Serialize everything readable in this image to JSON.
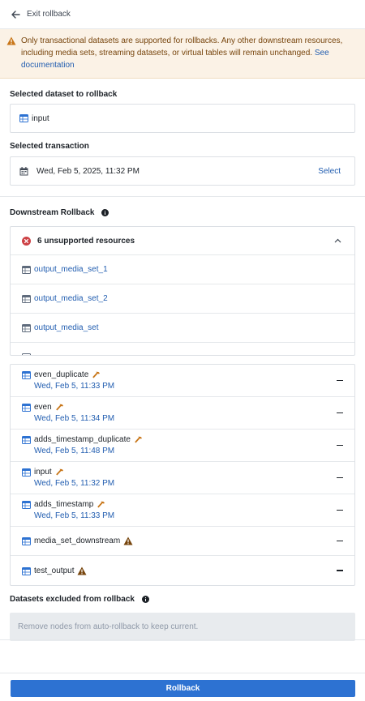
{
  "header": {
    "exit_label": "Exit rollback"
  },
  "warning": {
    "text": "Only transactional datasets are supported for rollbacks. Any other downstream resources, including media sets, streaming datasets, or virtual tables will remain unchanged.",
    "link": "See documentation"
  },
  "selected_dataset": {
    "label": "Selected dataset to rollback",
    "value": "input"
  },
  "selected_transaction": {
    "label": "Selected transaction",
    "value": "Wed, Feb 5, 2025, 11:32 PM",
    "action": "Select"
  },
  "downstream": {
    "label": "Downstream Rollback",
    "unsupported_title": "6 unsupported resources",
    "unsupported_items": [
      "output_media_set_1",
      "output_media_set_2",
      "output_media_set"
    ],
    "datasets": [
      {
        "name": "even_duplicate",
        "date": "Wed, Feb 5, 11:33 PM",
        "icon": "hammer-icon"
      },
      {
        "name": "even",
        "date": "Wed, Feb 5, 11:34 PM",
        "icon": "hammer-icon"
      },
      {
        "name": "adds_timestamp_duplicate",
        "date": "Wed, Feb 5, 11:48 PM",
        "icon": "hammer-icon"
      },
      {
        "name": "input",
        "date": "Wed, Feb 5, 11:32 PM",
        "icon": "hammer-icon"
      },
      {
        "name": "adds_timestamp",
        "date": "Wed, Feb 5, 11:33 PM",
        "icon": "hammer-icon"
      },
      {
        "name": "media_set_downstream",
        "date": "",
        "icon": "warning-icon"
      },
      {
        "name": "test_output",
        "date": "",
        "icon": "warning-icon"
      }
    ]
  },
  "excluded": {
    "label": "Datasets excluded from rollback",
    "placeholder": "Remove nodes from auto-rollback to keep current."
  },
  "footer": {
    "rollback_label": "Rollback"
  },
  "colors": {
    "accent": "#2d72d2",
    "link": "#215db0",
    "warning_bg": "#fbf2e6",
    "warning_text": "#77450d",
    "error": "#cd4246",
    "hammer": "#c87619"
  }
}
